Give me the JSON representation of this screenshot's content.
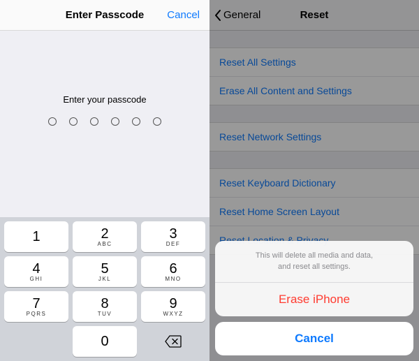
{
  "left": {
    "nav_title": "Enter Passcode",
    "nav_cancel": "Cancel",
    "prompt": "Enter your passcode",
    "passcode_length": 6,
    "keypad": [
      {
        "num": "1",
        "letters": ""
      },
      {
        "num": "2",
        "letters": "ABC"
      },
      {
        "num": "3",
        "letters": "DEF"
      },
      {
        "num": "4",
        "letters": "GHI"
      },
      {
        "num": "5",
        "letters": "JKL"
      },
      {
        "num": "6",
        "letters": "MNO"
      },
      {
        "num": "7",
        "letters": "PQRS"
      },
      {
        "num": "8",
        "letters": "TUV"
      },
      {
        "num": "9",
        "letters": "WXYZ"
      },
      {
        "num": "0",
        "letters": ""
      }
    ]
  },
  "right": {
    "nav_back": "General",
    "nav_title": "Reset",
    "groups": [
      [
        "Reset All Settings",
        "Erase All Content and Settings"
      ],
      [
        "Reset Network Settings"
      ],
      [
        "Reset Keyboard Dictionary",
        "Reset Home Screen Layout",
        "Reset Location & Privacy"
      ]
    ],
    "sheet": {
      "message": "This will delete all media and data,\nand reset all settings.",
      "destructive": "Erase iPhone",
      "cancel": "Cancel"
    }
  },
  "colors": {
    "ios_blue": "#0e7afe",
    "ios_red": "#ff3b30"
  }
}
